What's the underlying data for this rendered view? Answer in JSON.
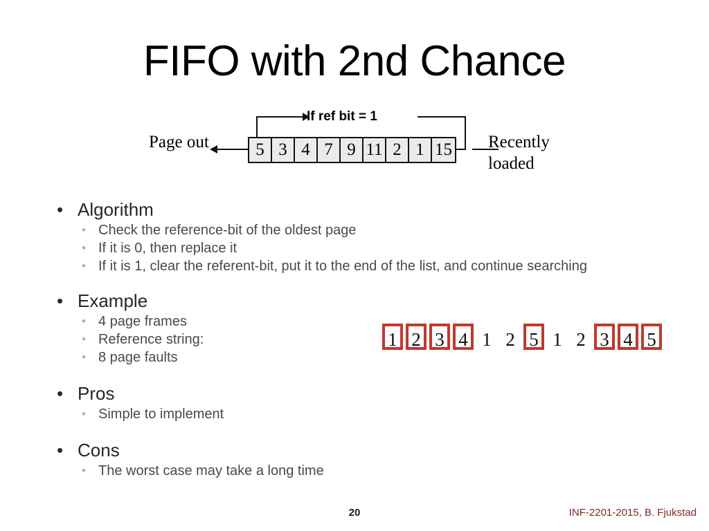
{
  "slide": {
    "title": "FIFO with 2nd Chance"
  },
  "diagram": {
    "label_left": "Page out",
    "label_right": "Recently loaded",
    "label_top": "If ref bit = 1",
    "queue": [
      "5",
      "3",
      "4",
      "7",
      "9",
      "11",
      "2",
      "1",
      "15"
    ]
  },
  "content": {
    "algorithm": {
      "heading": "Algorithm",
      "items": [
        "Check the reference-bit of the oldest page",
        "If it is 0, then replace it",
        "If it is 1, clear the referent-bit, put it to the end of the list, and continue searching"
      ]
    },
    "example": {
      "heading": "Example",
      "items": [
        "4 page frames",
        "Reference string:",
        "8 page faults"
      ]
    },
    "pros": {
      "heading": "Pros",
      "items": [
        "Simple to implement"
      ]
    },
    "cons": {
      "heading": "Cons",
      "items": [
        "The worst case may take a long time"
      ]
    }
  },
  "reference_string": {
    "fault_color": "#c0392b",
    "items": [
      {
        "value": "1",
        "fault": true
      },
      {
        "value": "2",
        "fault": true
      },
      {
        "value": "3",
        "fault": true
      },
      {
        "value": "4",
        "fault": true
      },
      {
        "value": "1",
        "fault": false
      },
      {
        "value": "2",
        "fault": false
      },
      {
        "value": "5",
        "fault": true
      },
      {
        "value": "1",
        "fault": false
      },
      {
        "value": "2",
        "fault": false
      },
      {
        "value": "3",
        "fault": true
      },
      {
        "value": "4",
        "fault": true
      },
      {
        "value": "5",
        "fault": true
      }
    ]
  },
  "footer": {
    "page_number": "20",
    "credit": "INF-2201-2015, B. Fjukstad"
  },
  "markers": {
    "level1": "•",
    "level2": "•"
  }
}
